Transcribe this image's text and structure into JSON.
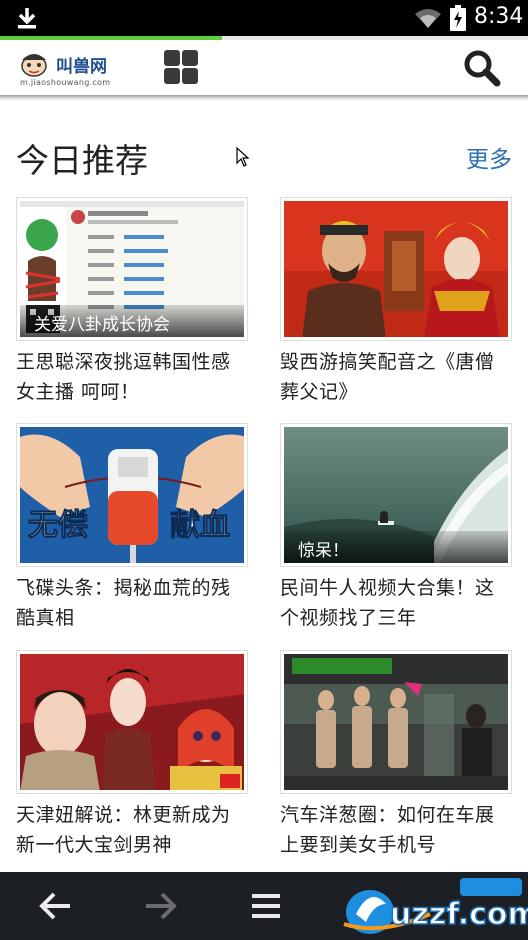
{
  "status_bar": {
    "time": "8:34"
  },
  "page_progress": 0.42,
  "header": {
    "logo_name": "叫兽网",
    "logo_url": "m.jiaoshouwang.com"
  },
  "section": {
    "title": "今日推荐",
    "more": "更多"
  },
  "cards": [
    {
      "title": "王思聪深夜挑逗韩国性感女主播 呵呵！",
      "overlay": "关爱八卦成长协会",
      "thumb": "weibo-screenshot"
    },
    {
      "title": "毁西游搞笑配音之《唐僧葬父记》",
      "overlay": "",
      "thumb": "journey-west-actors"
    },
    {
      "title": "飞碟头条：揭秘血荒的残酷真相",
      "overlay": "",
      "thumb": "blood-donation"
    },
    {
      "title": "民间牛人视频大合集！这个视频找了三年",
      "overlay": "惊呆！",
      "thumb": "surfing-wave"
    },
    {
      "title": "天津妞解说：林更新成为新一代大宝剑男神",
      "overlay": "",
      "thumb": "costume-drama"
    },
    {
      "title": "汽车洋葱圈：如何在车展上要到美女手机号",
      "overlay": "",
      "thumb": "car-show"
    }
  ],
  "thumb_texts": {
    "blood_left": "无偿",
    "blood_right": "献血"
  },
  "colors": {
    "accent": "#2d6fb0",
    "progress": "#5ad13a",
    "navbar": "#1c1f24"
  }
}
